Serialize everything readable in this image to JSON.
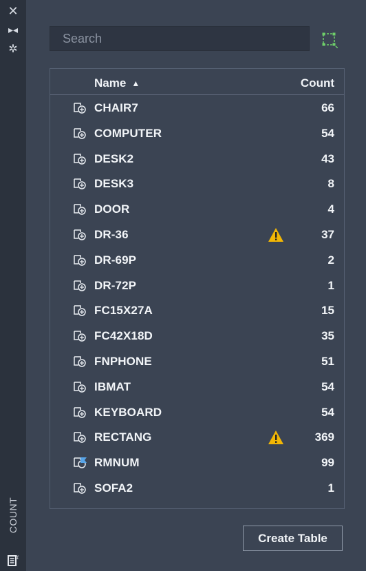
{
  "sidebar": {
    "title": "COUNT"
  },
  "search": {
    "placeholder": "Search",
    "value": ""
  },
  "table": {
    "columns": [
      "Name",
      "Count"
    ],
    "sort_indicator": "▲",
    "rows": [
      {
        "name": "CHAIR7",
        "count": "66",
        "warning": false,
        "icon": "block-count-icon"
      },
      {
        "name": "COMPUTER",
        "count": "54",
        "warning": false,
        "icon": "block-count-icon"
      },
      {
        "name": "DESK2",
        "count": "43",
        "warning": false,
        "icon": "block-count-icon"
      },
      {
        "name": "DESK3",
        "count": "8",
        "warning": false,
        "icon": "block-count-icon"
      },
      {
        "name": "DOOR",
        "count": "4",
        "warning": false,
        "icon": "block-count-icon"
      },
      {
        "name": "DR-36",
        "count": "37",
        "warning": true,
        "icon": "block-count-icon"
      },
      {
        "name": "DR-69P",
        "count": "2",
        "warning": false,
        "icon": "block-count-icon"
      },
      {
        "name": "DR-72P",
        "count": "1",
        "warning": false,
        "icon": "block-count-icon"
      },
      {
        "name": "FC15X27A",
        "count": "15",
        "warning": false,
        "icon": "block-count-icon"
      },
      {
        "name": "FC42X18D",
        "count": "35",
        "warning": false,
        "icon": "block-count-icon"
      },
      {
        "name": "FNPHONE",
        "count": "51",
        "warning": false,
        "icon": "block-count-icon"
      },
      {
        "name": "IBMAT",
        "count": "54",
        "warning": false,
        "icon": "block-count-icon"
      },
      {
        "name": "KEYBOARD",
        "count": "54",
        "warning": false,
        "icon": "block-count-icon"
      },
      {
        "name": "RECTANG",
        "count": "369",
        "warning": true,
        "icon": "block-count-icon"
      },
      {
        "name": "RMNUM",
        "count": "99",
        "warning": false,
        "icon": "attribute-block-icon"
      },
      {
        "name": "SOFA2",
        "count": "1",
        "warning": false,
        "icon": "block-count-icon"
      }
    ]
  },
  "footer": {
    "create_table_label": "Create Table"
  },
  "colors": {
    "background": "#3b4453",
    "sidebar": "#2b323d",
    "search_bg": "#2e3542",
    "warning": "#f2b705",
    "select_icon": "#6fd06a",
    "attribute_flag": "#58a5e8"
  }
}
